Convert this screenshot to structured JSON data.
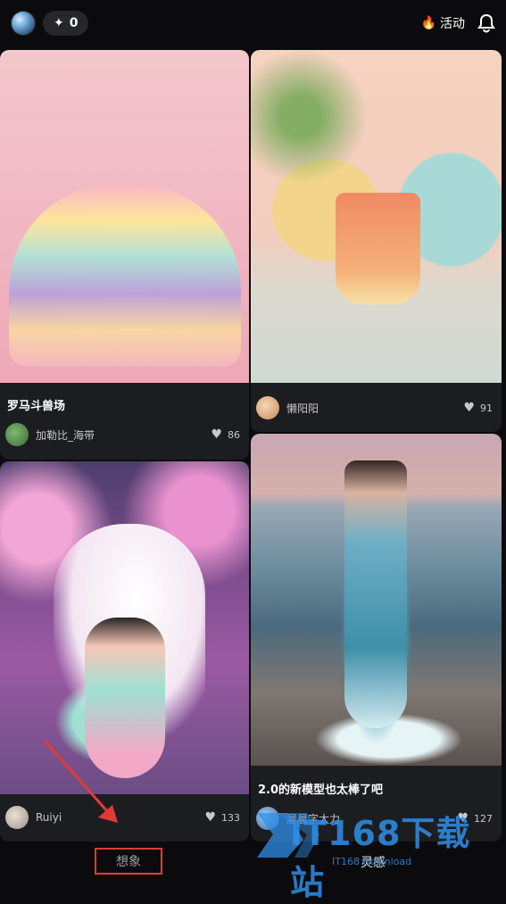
{
  "topbar": {
    "points_value": "0",
    "activity_label": "活动",
    "icons": [
      "profile-orb-icon",
      "sparkle-icon",
      "flame-icon",
      "bell-icon"
    ]
  },
  "cards": [
    {
      "title": "罗马斗兽场",
      "author": "加勒比_海带",
      "likes": "86"
    },
    {
      "title": "",
      "author": "懒阳阳",
      "likes": "91"
    },
    {
      "title": "",
      "author": "Ruiyi",
      "likes": "133"
    },
    {
      "title": "2.0的新模型也太棒了吧",
      "author": "晨晨字太力",
      "likes": "127"
    }
  ],
  "tabs": {
    "left": "想象",
    "right": "灵感"
  },
  "watermark": {
    "text": "IT168下载站",
    "sub": "IT168 Download"
  },
  "colors": {
    "highlight_box": "#e53935",
    "background": "#0b0b0d",
    "card": "#1c1d21"
  }
}
